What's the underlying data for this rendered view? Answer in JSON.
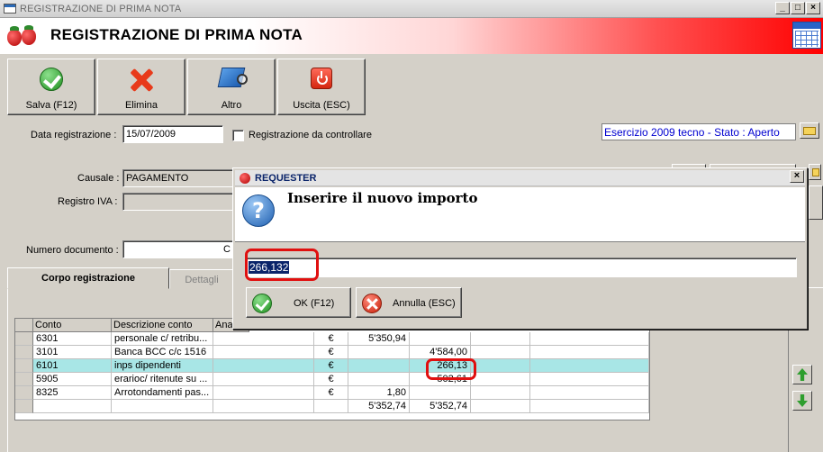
{
  "window": {
    "title": "REGISTRAZIONE DI PRIMA NOTA",
    "min_glyph": "_",
    "max_glyph": "□",
    "close_glyph": "×"
  },
  "header": {
    "title": "REGISTRAZIONE DI PRIMA NOTA"
  },
  "toolbar": {
    "save_label": "Salva (F12)",
    "delete_label": "Elimina",
    "other_label": "Altro",
    "exit_label": "Uscita (ESC)"
  },
  "form": {
    "data_label": "Data registrazione :",
    "data_value": "15/07/2009",
    "check_label": "Registrazione da controllare",
    "esercizio": "Esercizio 2009 tecno - Stato : Aperto",
    "causale_label": "Causale :",
    "causale_value": "PAGAMENTO",
    "registro_label": "Registro IVA :",
    "numero_label": "Numero documento :",
    "numero_partial": "C"
  },
  "tabs": [
    {
      "label": "Corpo registrazione",
      "active": true
    },
    {
      "label": "Dettagli",
      "active": false
    }
  ],
  "grid": {
    "columns": [
      "Conto",
      "Descrizione conto",
      "Anag"
    ],
    "rows": [
      {
        "conto": "6301",
        "descr": "personale c/ retribu...",
        "cur": "€",
        "dare": "5'350,94",
        "avere": ""
      },
      {
        "conto": "3101",
        "descr": "Banca BCC c/c 1516",
        "cur": "€",
        "dare": "",
        "avere": "4'584,00"
      },
      {
        "conto": "6101",
        "descr": "inps dipendenti",
        "cur": "€",
        "dare": "",
        "avere": "266,13",
        "selected": true
      },
      {
        "conto": "5905",
        "descr": "erarioc/ ritenute su ...",
        "cur": "€",
        "dare": "",
        "avere": "502,61"
      },
      {
        "conto": "8325",
        "descr": "Arrotondamenti pas...",
        "cur": "€",
        "dare": "1,80",
        "avere": ""
      }
    ],
    "totals": {
      "dare": "5'352,74",
      "avere": "5'352,74"
    }
  },
  "dialog": {
    "title": "REQUESTER",
    "message": "Inserire il nuovo importo",
    "value": "266,132",
    "ok_label": "OK (F12)",
    "cancel_label": "Annulla (ESC)",
    "close_glyph": "×",
    "question_glyph": "?"
  },
  "colors": {
    "selected_row": "#a8e6e6",
    "annotation_red": "#e01010",
    "esercizio_text": "#0000d0"
  }
}
